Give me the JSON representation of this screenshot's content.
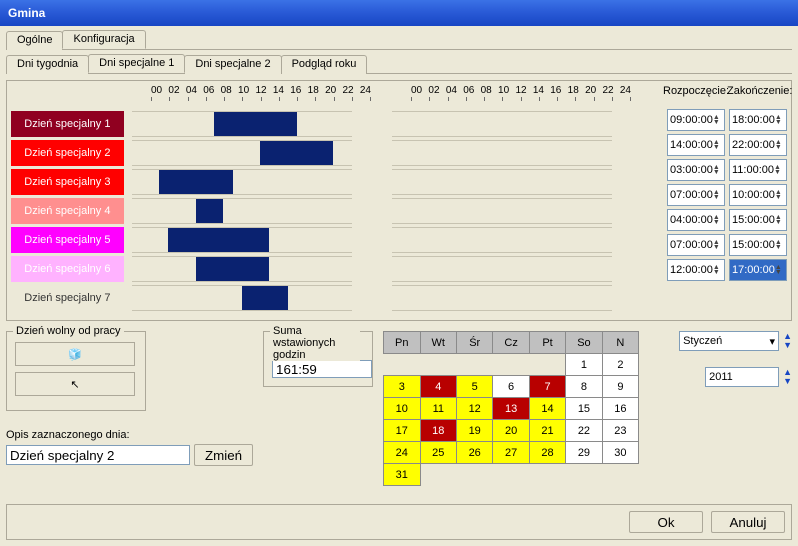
{
  "window": {
    "title": "Gmina"
  },
  "tabs": {
    "top": [
      "Ogólne",
      "Konfiguracja"
    ],
    "top_active": 1,
    "sub": [
      "Dni tygodnia",
      "Dni specjalne 1",
      "Dni specjalne 2",
      "Podgląd roku"
    ],
    "sub_active": 1
  },
  "hours": [
    "00",
    "02",
    "04",
    "06",
    "08",
    "10",
    "12",
    "14",
    "16",
    "18",
    "20",
    "22",
    "24"
  ],
  "time_headers": {
    "start": "Rozpoczęcie:",
    "end": "Zakończenie:"
  },
  "rows": [
    {
      "label": "Dzień specjalny 1",
      "color": "#900020",
      "start": "09:00:00",
      "end": "18:00:00",
      "bar_from": 9,
      "bar_to": 18
    },
    {
      "label": "Dzień specjalny 2",
      "color": "#ff0000",
      "start": "14:00:00",
      "end": "22:00:00",
      "bar_from": 14,
      "bar_to": 22
    },
    {
      "label": "Dzień specjalny 3",
      "color": "#ff0000",
      "start": "03:00:00",
      "end": "11:00:00",
      "bar_from": 3,
      "bar_to": 11
    },
    {
      "label": "Dzień specjalny 4",
      "color": "#ff8f8f",
      "start": "07:00:00",
      "end": "10:00:00",
      "bar_from": 7,
      "bar_to": 10
    },
    {
      "label": "Dzień specjalny 5",
      "color": "#ff00ff",
      "start": "04:00:00",
      "end": "15:00:00",
      "bar_from": 4,
      "bar_to": 15
    },
    {
      "label": "Dzień specjalny 6",
      "color": "#ffb2ff",
      "start": "07:00:00",
      "end": "15:00:00",
      "bar_from": 7,
      "bar_to": 15
    },
    {
      "label": "Dzień specjalny 7",
      "color": "#ece9d8",
      "start": "12:00:00",
      "end": "17:00:00",
      "bar_from": 12,
      "bar_to": 17,
      "text": "#333"
    }
  ],
  "free_day": {
    "legend": "Dzień wolny od pracy"
  },
  "sum": {
    "legend": "Suma wstawionych godzin",
    "value": "161:59"
  },
  "desc": {
    "legend": "Opis zaznaczonego dnia:",
    "value": "Dzień specjalny 2",
    "btn": "Zmień"
  },
  "calendar": {
    "headers": [
      "Pn",
      "Wt",
      "Śr",
      "Cz",
      "Pt",
      "So",
      "N"
    ],
    "weeks": [
      [
        {
          "d": "",
          "c": "e"
        },
        {
          "d": "",
          "c": "e"
        },
        {
          "d": "",
          "c": "e"
        },
        {
          "d": "",
          "c": "e"
        },
        {
          "d": "",
          "c": "e"
        },
        {
          "d": "1",
          "c": ""
        },
        {
          "d": "2",
          "c": ""
        }
      ],
      [
        {
          "d": "3",
          "c": "y"
        },
        {
          "d": "4",
          "c": "r"
        },
        {
          "d": "5",
          "c": "y"
        },
        {
          "d": "6",
          "c": ""
        },
        {
          "d": "7",
          "c": "r"
        },
        {
          "d": "8",
          "c": ""
        },
        {
          "d": "9",
          "c": ""
        }
      ],
      [
        {
          "d": "10",
          "c": "y"
        },
        {
          "d": "11",
          "c": "y"
        },
        {
          "d": "12",
          "c": "y"
        },
        {
          "d": "13",
          "c": "r"
        },
        {
          "d": "14",
          "c": "y"
        },
        {
          "d": "15",
          "c": ""
        },
        {
          "d": "16",
          "c": ""
        }
      ],
      [
        {
          "d": "17",
          "c": "y"
        },
        {
          "d": "18",
          "c": "r"
        },
        {
          "d": "19",
          "c": "y"
        },
        {
          "d": "20",
          "c": "y"
        },
        {
          "d": "21",
          "c": "y"
        },
        {
          "d": "22",
          "c": ""
        },
        {
          "d": "23",
          "c": ""
        }
      ],
      [
        {
          "d": "24",
          "c": "y"
        },
        {
          "d": "25",
          "c": "y"
        },
        {
          "d": "26",
          "c": "y"
        },
        {
          "d": "27",
          "c": "y"
        },
        {
          "d": "28",
          "c": "y"
        },
        {
          "d": "29",
          "c": ""
        },
        {
          "d": "30",
          "c": ""
        }
      ],
      [
        {
          "d": "31",
          "c": "y"
        },
        {
          "d": "",
          "c": "e"
        },
        {
          "d": "",
          "c": "e"
        },
        {
          "d": "",
          "c": "e"
        },
        {
          "d": "",
          "c": "e"
        },
        {
          "d": "",
          "c": "e"
        },
        {
          "d": "",
          "c": "e"
        }
      ]
    ]
  },
  "month": "Styczeń",
  "year": "2011",
  "footer": {
    "ok": "Ok",
    "cancel": "Anuluj"
  }
}
